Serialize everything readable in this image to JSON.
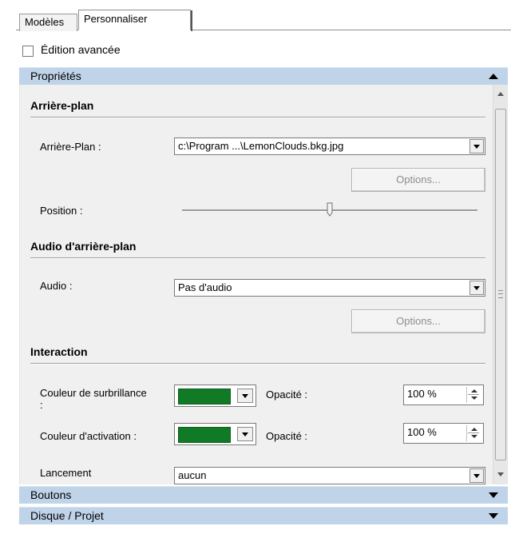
{
  "tabs": [
    {
      "label": "Modèles"
    },
    {
      "label": "Personnaliser"
    }
  ],
  "advanced_edit": {
    "label": "Édition avancée",
    "checked": false
  },
  "sections": {
    "properties": {
      "label": "Propriétés",
      "expanded": true
    },
    "buttons": {
      "label": "Boutons",
      "expanded": false
    },
    "disc_project": {
      "label": "Disque / Projet",
      "expanded": false
    }
  },
  "background": {
    "title": "Arrière-plan",
    "file_label": "Arrière-Plan :",
    "file_value": "c:\\Program ...\\LemonClouds.bkg.jpg",
    "options_label": "Options...",
    "position_label": "Position :",
    "position_value": 0.5
  },
  "audio": {
    "title": "Audio d'arrière-plan",
    "label": "Audio :",
    "value": "Pas d'audio",
    "options_label": "Options..."
  },
  "interaction": {
    "title": "Interaction",
    "highlight_label": "Couleur de surbrillance :",
    "highlight_color": "#117a26",
    "highlight_opacity_label": "Opacité :",
    "highlight_opacity": "100 %",
    "activation_label": "Couleur d'activation :",
    "activation_color": "#117a26",
    "activation_opacity_label": "Opacité :",
    "activation_opacity": "100 %",
    "launch_label": "Lancement",
    "launch_value": "aucun"
  },
  "colors": {
    "header_bar": "#bfd3e9",
    "panel_bg": "#f0f0f0"
  }
}
